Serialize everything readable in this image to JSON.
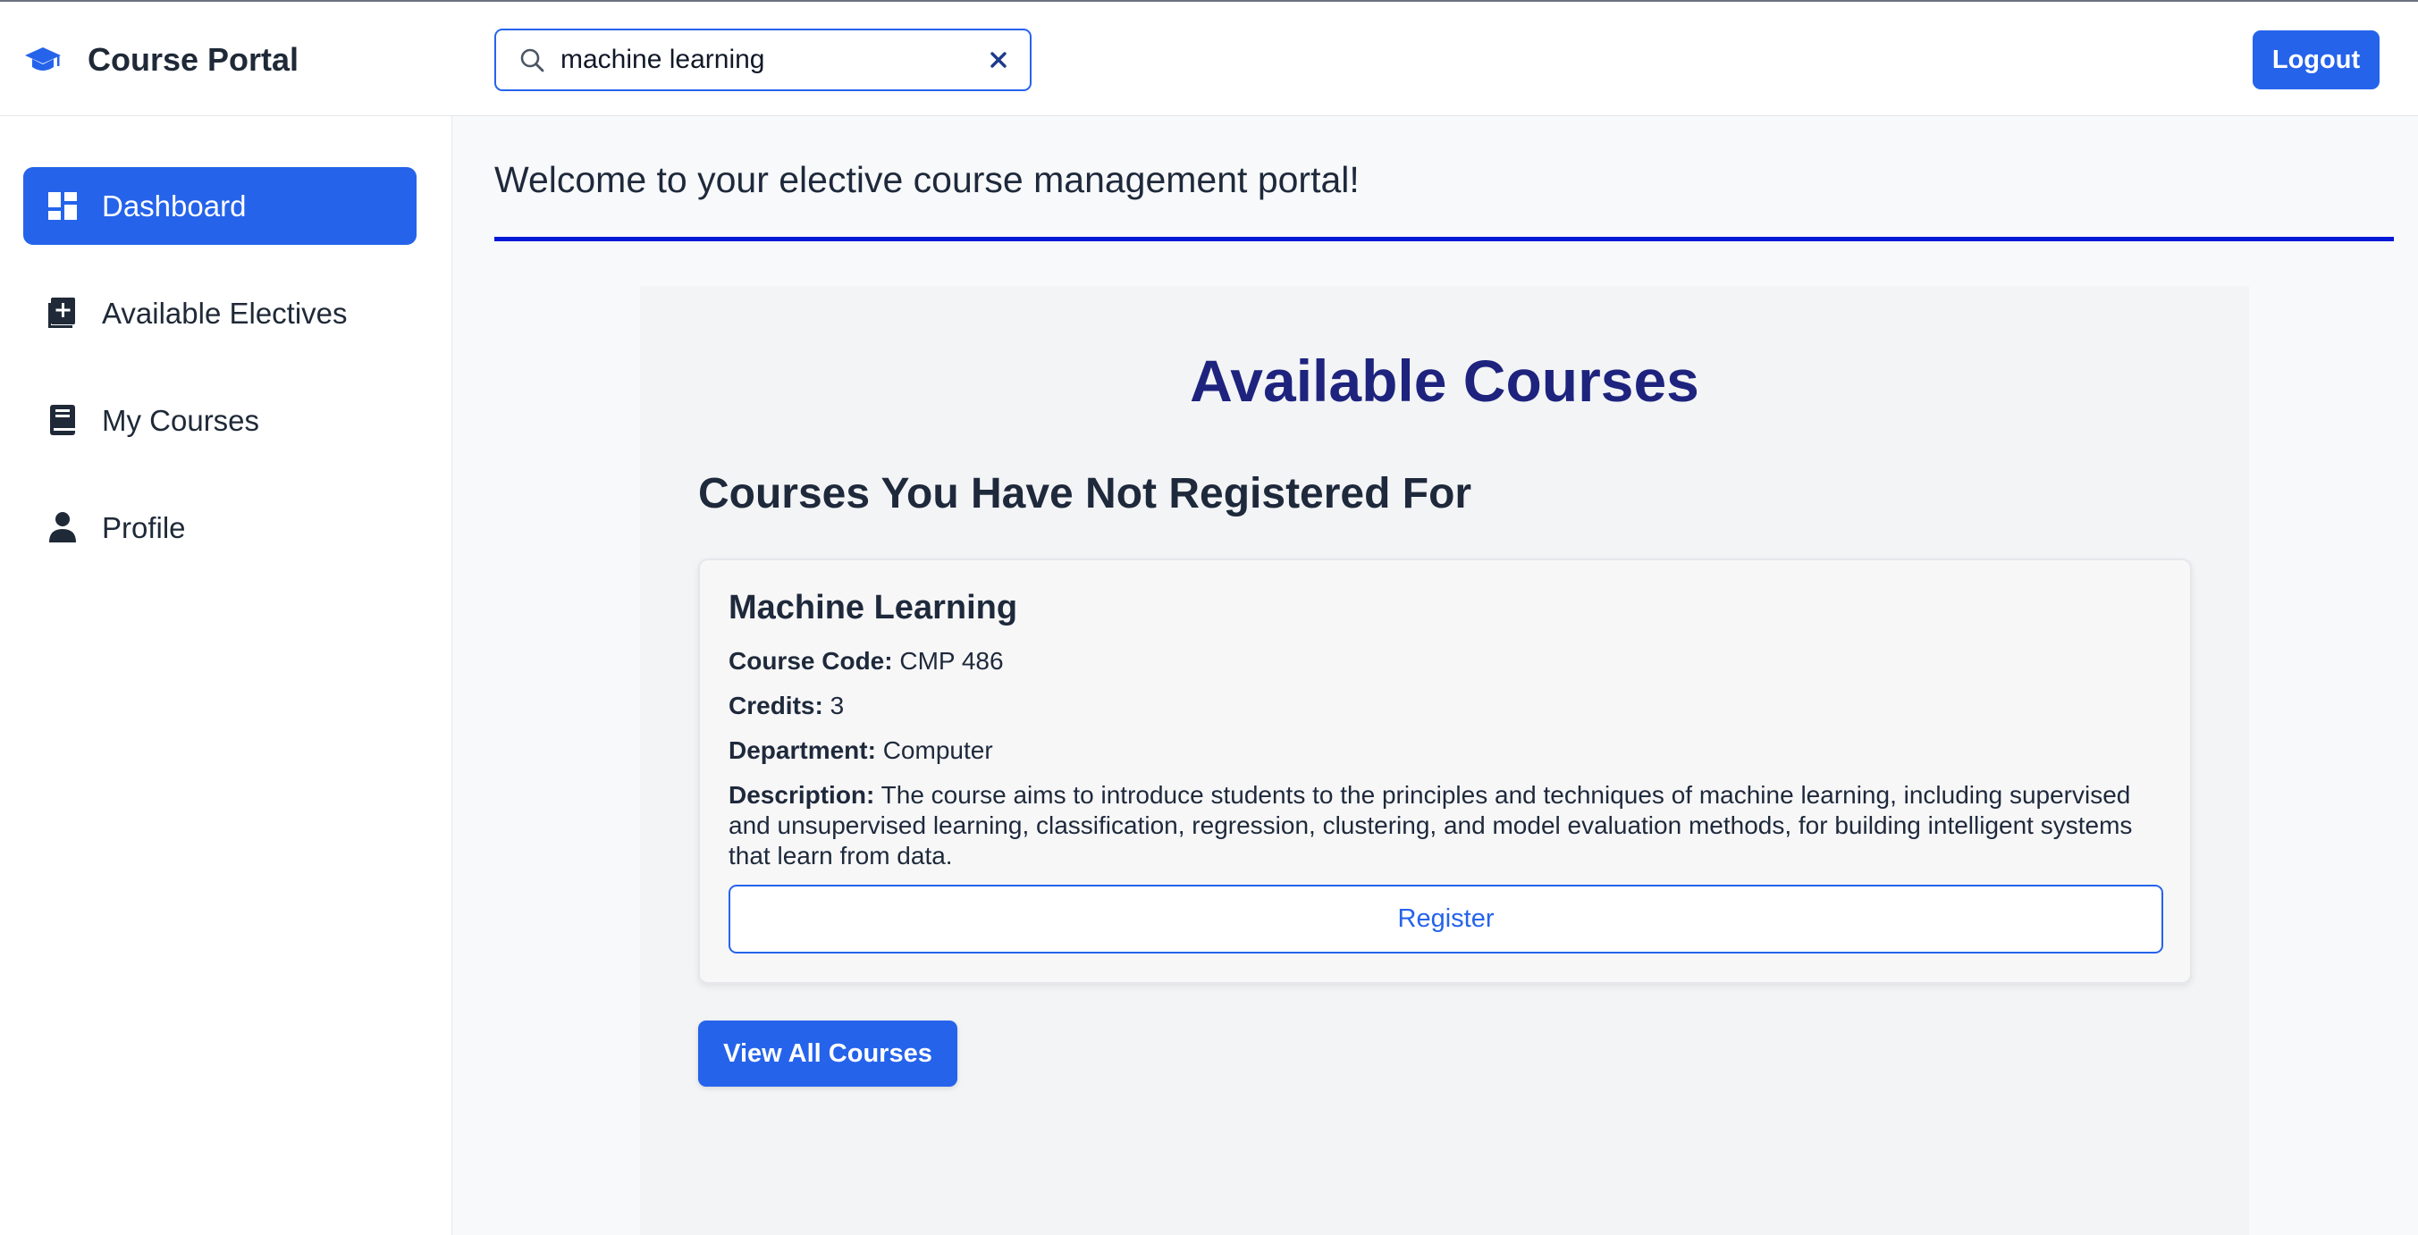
{
  "header": {
    "brand_title": "Course Portal",
    "brand_icon": "graduation-cap-icon",
    "search": {
      "value": "machine learning",
      "placeholder": "Search courses",
      "icon": "search-icon",
      "clear_icon": "close-icon"
    },
    "logout_label": "Logout"
  },
  "sidebar": {
    "items": [
      {
        "label": "Dashboard",
        "icon": "dashboard-icon",
        "active": true
      },
      {
        "label": "Available Electives",
        "icon": "add-book-icon",
        "active": false
      },
      {
        "label": "My Courses",
        "icon": "book-icon",
        "active": false
      },
      {
        "label": "Profile",
        "icon": "person-icon",
        "active": false
      }
    ]
  },
  "main": {
    "welcome_text": "Welcome to your elective course management portal!",
    "panel_title": "Available Courses",
    "section_title": "Courses You Have Not Registered For",
    "course": {
      "title": "Machine Learning",
      "code_label": "Course Code:",
      "code_value": "CMP 486",
      "credits_label": "Credits:",
      "credits_value": "3",
      "department_label": "Department:",
      "department_value": "Computer",
      "description_label": "Description:",
      "description_value": "The course aims to introduce students to the principles and techniques of machine learning, including supervised and unsupervised learning, classification, regression, clustering, and model evaluation methods, for building intelligent systems that learn from data.",
      "register_label": "Register"
    },
    "view_all_label": "View All Courses"
  },
  "colors": {
    "primary": "#2563eb",
    "heading_navy": "#1e237e",
    "rule_blue": "#0018d8"
  }
}
